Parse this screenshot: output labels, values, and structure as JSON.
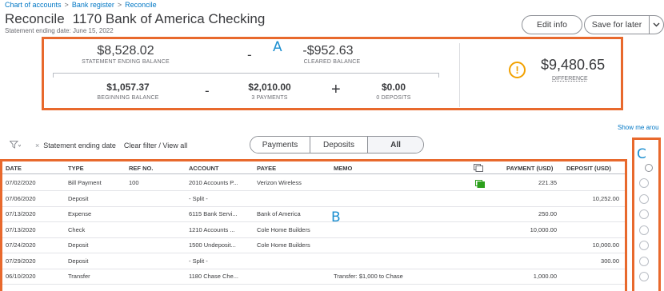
{
  "breadcrumb": [
    "Chart of accounts",
    "Bank register",
    "Reconcile"
  ],
  "header": {
    "title": "Reconcile",
    "account": "1170 Bank of America Checking",
    "statement_date": "Statement ending date: June 15, 2022",
    "edit_info": "Edit info",
    "save_for_later": "Save for later",
    "dropdown_icon": "chevron-down-icon"
  },
  "summary": {
    "statement_ending_balance": "$8,528.02",
    "statement_ending_balance_label": "STATEMENT ENDING BALANCE",
    "minus_1": "-",
    "cleared_balance": "-$952.63",
    "cleared_balance_label": "CLEARED BALANCE",
    "beginning_balance": "$1,057.37",
    "beginning_balance_label": "BEGINNING BALANCE",
    "minus_2": "-",
    "payments": "$2,010.00",
    "payments_label": "3 PAYMENTS",
    "plus": "+",
    "deposits": "$0.00",
    "deposits_label": "0 DEPOSITS",
    "difference": "$9,480.65",
    "difference_label": "DIFFERENCE",
    "warning_icon": "!"
  },
  "annotations": {
    "a": "A",
    "b": "B",
    "c": "C"
  },
  "show_me": "Show me arou",
  "filter": {
    "x": "×",
    "label": "Statement ending date",
    "clear": "Clear filter / View all"
  },
  "tabs": [
    "Payments",
    "Deposits",
    "All"
  ],
  "table": {
    "headers": [
      "DATE",
      "TYPE",
      "REF NO.",
      "ACCOUNT",
      "PAYEE",
      "MEMO",
      "PAYMENT (USD)",
      "DEPOSIT (USD)"
    ],
    "rows": [
      {
        "date": "07/02/2020",
        "type": "Bill Payment",
        "ref": "100",
        "account": "2010 Accounts P...",
        "payee": "Verizon Wireless",
        "memo": "",
        "payment": "221.35",
        "deposit": "",
        "attachment": true
      },
      {
        "date": "07/06/2020",
        "type": "Deposit",
        "ref": "",
        "account": "- Split -",
        "payee": "",
        "memo": "",
        "payment": "",
        "deposit": "10,252.00",
        "attachment": false
      },
      {
        "date": "07/13/2020",
        "type": "Expense",
        "ref": "",
        "account": "6115 Bank Servi...",
        "payee": "Bank of America",
        "memo": "",
        "payment": "250.00",
        "deposit": "",
        "attachment": false
      },
      {
        "date": "07/13/2020",
        "type": "Check",
        "ref": "",
        "account": "1210 Accounts ...",
        "payee": "Cole Home Builders",
        "memo": "",
        "payment": "10,000.00",
        "deposit": "",
        "attachment": false
      },
      {
        "date": "07/24/2020",
        "type": "Deposit",
        "ref": "",
        "account": "1500 Undeposit...",
        "payee": "Cole Home Builders",
        "memo": "",
        "payment": "",
        "deposit": "10,000.00",
        "attachment": false
      },
      {
        "date": "07/29/2020",
        "type": "Deposit",
        "ref": "",
        "account": "- Split -",
        "payee": "",
        "memo": "",
        "payment": "",
        "deposit": "300.00",
        "attachment": false
      },
      {
        "date": "06/10/2020",
        "type": "Transfer",
        "ref": "",
        "account": "1180 Chase Che...",
        "payee": "",
        "memo": "Transfer: $1,000 to Chase",
        "payment": "1,000.00",
        "deposit": "",
        "attachment": false
      }
    ]
  },
  "colors": {
    "highlight": "#e8692d",
    "link": "#0077c5",
    "annotation": "#1c8fd0",
    "warning": "#f2a100",
    "attachment": "#2ca01c"
  }
}
